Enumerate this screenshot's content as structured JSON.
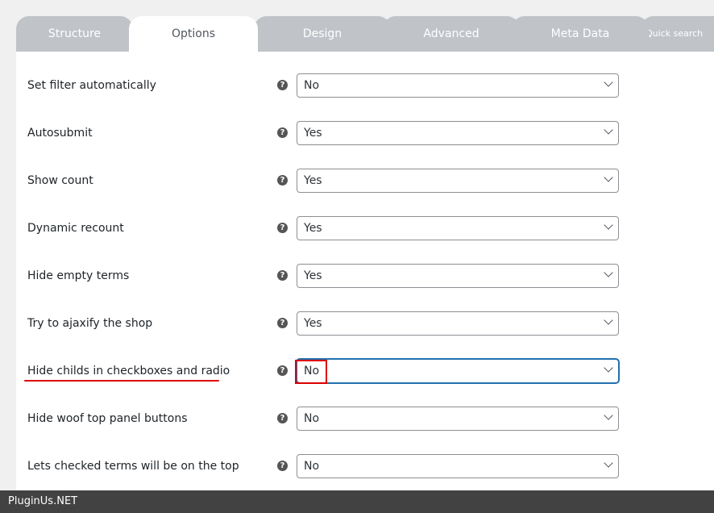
{
  "tabs": [
    "Structure",
    "Options",
    "Design",
    "Advanced",
    "Meta Data",
    "Quick search"
  ],
  "active_tab": "Options",
  "options": [
    {
      "label": "Set filter automatically",
      "value": "No"
    },
    {
      "label": "Autosubmit",
      "value": "Yes"
    },
    {
      "label": "Show count",
      "value": "Yes"
    },
    {
      "label": "Dynamic recount",
      "value": "Yes"
    },
    {
      "label": "Hide empty terms",
      "value": "Yes"
    },
    {
      "label": "Try to ajaxify the shop",
      "value": "Yes"
    },
    {
      "label": "Hide childs in checkboxes and radio",
      "value": "No"
    },
    {
      "label": "Hide woof top panel buttons",
      "value": "No"
    },
    {
      "label": "Lets checked terms will be on the top",
      "value": "No"
    }
  ],
  "help_glyph": "?",
  "footer": {
    "brand": "PluginUs.NET"
  }
}
